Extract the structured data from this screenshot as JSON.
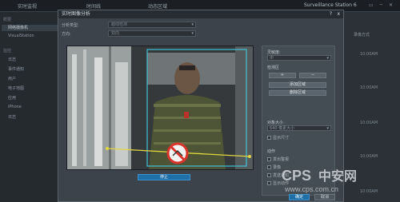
{
  "topbar": {
    "tabs": [
      "实时监视",
      "时间线",
      "动态区域"
    ],
    "app_title": "Surveillance Station 6"
  },
  "sidebar": {
    "section1": "概要",
    "items1": [
      "网络摄像机",
      "VisualStation"
    ],
    "section2": "监控",
    "items2": [
      "日志",
      "事件通知",
      "用户",
      "电子地图",
      "应用",
      "iPhone",
      "日志"
    ]
  },
  "right_col": {
    "header": "录像方式",
    "values": [
      "10:00AM",
      "10:00AM",
      "10:00AM",
      "10:00AM",
      "10:00AM"
    ]
  },
  "dialog": {
    "title": "实时图像分析",
    "help": "?",
    "close": "x",
    "analysis_type_label": "分析类型:",
    "analysis_type_value": "越线检测",
    "direction_label": "方向:",
    "direction_value": "双向",
    "stop_label": "停止",
    "ok_label": "确定",
    "cancel_label": "取消"
  },
  "right_panel": {
    "sensitivity_label": "灵敏度:",
    "sensitivity_value": "中",
    "detection_zone_label": "检测区",
    "add_symbol": "+",
    "remove_symbol": "−",
    "add_zone": "添加区域",
    "remove_zone": "删除区域",
    "object_size_label": "对象大小",
    "object_size_value": "640 像素大小",
    "object_size_check": "显示尺寸",
    "action_label": "动作",
    "action_items": [
      "发出警报",
      "录像",
      "发送通知",
      "显示动作"
    ]
  },
  "watermark": {
    "text_latin": "CPS",
    "text_cn": "中安网",
    "url": "www.cps.com.cn"
  },
  "colors": {
    "accent": "#1f6fa8",
    "line": "#e0d640",
    "zone": "#3fc2d6",
    "no_symbol": "#d9342b"
  }
}
